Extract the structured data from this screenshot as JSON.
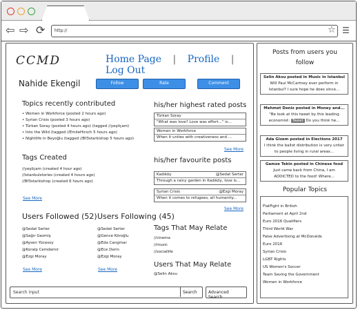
{
  "browser": {
    "url": "http://",
    "colors": {
      "close": "#e03a2e",
      "minimize": "#f0a030",
      "maximize": "#3aa040",
      "link": "#1565c0",
      "button": "#3d8fe6"
    }
  },
  "header": {
    "logo": "CCMD",
    "nav": {
      "home": "Home Page",
      "profile": "Profile",
      "logout": "Log Out",
      "sep": "|"
    }
  },
  "profile": {
    "name": "Nahide Ekengil",
    "buttons": {
      "follow": "Follow",
      "rate": "Rate",
      "comment": "Comment"
    }
  },
  "topics": {
    "title": "Topics recently contributed",
    "items": [
      "Women in Workforce  (posted 2 hours ago)",
      "Syrian Crisis  (posted 3 hours ago)",
      "Türkan Soray  (posted 4 hours ago) (tagged //yeşilçam)",
      "Into the Wild  (tagged //EmileHirsch 5 hours ago)",
      "Nightlife in Beyoğlu (tagged //Bf3starkishop 5 hours ago)"
    ]
  },
  "tags_created": {
    "title": "Tags Created",
    "items": [
      "//yeşilçam (created 4 hour ago)",
      "//istanbulstories (created 4 hours ago)",
      "//Bf3starkishop (created 6 hours ago)"
    ],
    "more": "See More"
  },
  "highest_rated": {
    "title": "his/her highest rated posts",
    "rows": [
      "Türkan Soray",
      "\"What was love? Love was effort...\" is...",
      "Women in Workforce",
      "When it unites with creativeness and ..."
    ],
    "more": "See More"
  },
  "favourite": {
    "title": "his/her favourite posts",
    "cards": [
      {
        "topic": "Kadıköy",
        "user": "@Sedat Serter",
        "text": "Through a rainy garden in Kadıköy, love is..."
      },
      {
        "topic": "Syrian Crisis",
        "user": "@Ezgi Moray",
        "text": "When it comes to refugees, all humanity..."
      }
    ],
    "more": "See More"
  },
  "followed": {
    "title": "Users Followed",
    "count": "(52)",
    "users": [
      "@Sedat Serter",
      "@Sağır Gezmiş",
      "@Aysen Yücesoy",
      "@Koralp Cemdemir",
      "@Ezgi Moray"
    ],
    "more": "See More"
  },
  "following": {
    "title": "Users Following",
    "count": "(45)",
    "users": [
      "@Sedat Serter",
      "@Gence Köroğlu",
      "@Eda Cangmar",
      "@Ece Derin",
      "@Ezgi Moray"
    ],
    "more": "See More"
  },
  "tags_relate": {
    "title": "Tags That May Relate",
    "items": [
      "//cinema",
      "//music",
      "//sociallife"
    ]
  },
  "users_relate": {
    "title": "Users That May Relate",
    "items": [
      "@Selin Aksu"
    ]
  },
  "search": {
    "placeholder": "Search input",
    "button": "Search",
    "advanced": "Advanced Search"
  },
  "sidebar": {
    "title": "Posts from users you follow",
    "posts": [
      {
        "head": "Selin Aksu posted in Music in Istanbul",
        "body": "Will Paul McCartney ever perform in Istanbul? I sure hope he does since..."
      },
      {
        "head": "Mehmet Deniz posted in Money and...",
        "body_pre": "\"Be look at this tweet by this leading economist: ",
        "tag": "Tweet",
        "body_post": " Do you think he..."
      },
      {
        "head": "Ada Gizem posted in Elections 2017",
        "body": "I think the ballot distribution is very unfair to people living in rural areas..."
      },
      {
        "head": "Gamze Tekin posted in Chinese food",
        "body": "Just came back from China, I am ADDICTED to the food! Where..."
      }
    ],
    "popular_title": "Popular Topics",
    "popular": [
      "FlatFight in British",
      "Parliament at April 2nd",
      "Euro 2016 Qualifiers",
      "Third World War",
      "False Advertising at McDonalds",
      "Euro 2016",
      "Syrian Crisis",
      "LGBT Rights",
      "US Women's Soccer",
      "Team Saving the Government",
      "Women in Workforce"
    ]
  }
}
